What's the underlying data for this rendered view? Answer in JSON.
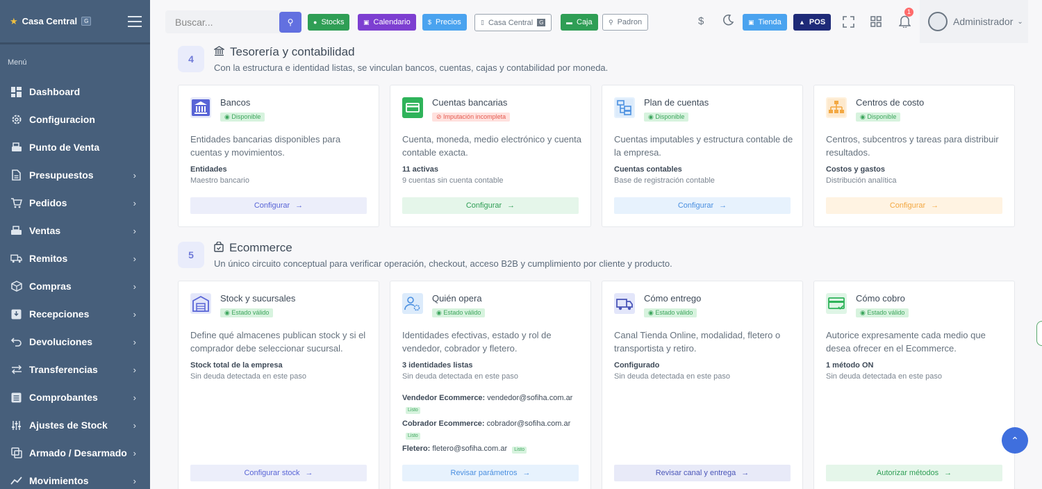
{
  "sidebar": {
    "brand": "Casa Central",
    "brand_badge": "G",
    "menu_title": "Menú",
    "items": [
      {
        "label": "Dashboard",
        "icon": "dashboard-icon",
        "chevron": false
      },
      {
        "label": "Configuracion",
        "icon": "gear-icon",
        "chevron": false
      },
      {
        "label": "Punto de Venta",
        "icon": "pos-icon",
        "chevron": false
      },
      {
        "label": "Presupuestos",
        "icon": "document-icon",
        "chevron": true
      },
      {
        "label": "Pedidos",
        "icon": "cart-icon",
        "chevron": true
      },
      {
        "label": "Ventas",
        "icon": "sales-icon",
        "chevron": true
      },
      {
        "label": "Remitos",
        "icon": "truck-icon",
        "chevron": true
      },
      {
        "label": "Compras",
        "icon": "box-icon",
        "chevron": true
      },
      {
        "label": "Recepciones",
        "icon": "inbox-icon",
        "chevron": true
      },
      {
        "label": "Devoluciones",
        "icon": "undo-icon",
        "chevron": true
      },
      {
        "label": "Transferencias",
        "icon": "transfer-icon",
        "chevron": true
      },
      {
        "label": "Comprobantes",
        "icon": "receipt-icon",
        "chevron": true
      },
      {
        "label": "Ajustes de Stock",
        "icon": "sliders-icon",
        "chevron": true
      },
      {
        "label": "Armado / Desarmado",
        "icon": "layers-icon",
        "chevron": true
      },
      {
        "label": "Movimientos",
        "icon": "chart-line-icon",
        "chevron": true
      }
    ]
  },
  "topbar": {
    "search_placeholder": "Buscar...",
    "buttons": {
      "stocks": "Stocks",
      "calendario": "Calendario",
      "precios": "Precios",
      "casa_central": "Casa Central",
      "casa_badge": "G",
      "caja": "Caja",
      "padron": "Padron",
      "tienda": "Tienda",
      "pos": "POS"
    },
    "notification_count": "1",
    "user": "Administrador"
  },
  "colors": {
    "sidebar": "#475f7b",
    "accent": "#6270e0",
    "green": "#2f9e55",
    "purple": "#7d3fd1",
    "blue": "#4aa3ef",
    "navy": "#1e2a78"
  },
  "section4": {
    "step": "4",
    "title": "Tesorería y contabilidad",
    "description": "Con la estructura e identidad listas, se vinculan bancos, cuentas, cajas y contabilidad por moneda.",
    "cards": [
      {
        "title": "Bancos",
        "badge": "Disponible",
        "desc": "Entidades bancarias disponibles para cuentas y movimientos.",
        "s1": "Entidades",
        "s2": "Maestro bancario",
        "button": "Configurar"
      },
      {
        "title": "Cuentas bancarias",
        "badge": "Imputación incompleta",
        "desc": "Cuenta, moneda, medio electrónico y cuenta contable exacta.",
        "s1": "11 activas",
        "s2": "9 cuentas sin cuenta contable",
        "button": "Configurar"
      },
      {
        "title": "Plan de cuentas",
        "badge": "Disponible",
        "desc": "Cuentas imputables y estructura contable de la empresa.",
        "s1": "Cuentas contables",
        "s2": "Base de registración contable",
        "button": "Configurar"
      },
      {
        "title": "Centros de costo",
        "badge": "Disponible",
        "desc": "Centros, subcentros y tareas para distribuir resultados.",
        "s1": "Costos y gastos",
        "s2": "Distribución analítica",
        "button": "Configurar"
      }
    ]
  },
  "section5": {
    "step": "5",
    "title": "Ecommerce",
    "description": "Un único circuito conceptual para verificar operación, checkout, acceso B2B y cumplimiento por cliente y producto.",
    "cards": [
      {
        "title": "Stock y sucursales",
        "badge": "Estado válido",
        "desc": "Define qué almacenes publican stock y si el comprador debe seleccionar sucursal.",
        "s1": "Stock total de la empresa",
        "s2": "Sin deuda detectada en este paso",
        "button": "Configurar stock"
      },
      {
        "title": "Quién opera",
        "badge": "Estado válido",
        "desc": "Identidades efectivas, estado y rol de vendedor, cobrador y fletero.",
        "s1": "3 identidades listas",
        "s2": "Sin deuda detectada en este paso",
        "button": "Revisar parámetros",
        "roles": [
          {
            "label": "Vendedor Ecommerce:",
            "email": "vendedor@sofiha.com.ar",
            "status": "Listo"
          },
          {
            "label": "Cobrador Ecommerce:",
            "email": "cobrador@sofiha.com.ar",
            "status": "Listo"
          },
          {
            "label": "Fletero:",
            "email": "fletero@sofiha.com.ar",
            "status": "Listo"
          }
        ]
      },
      {
        "title": "Cómo entrego",
        "badge": "Estado válido",
        "desc": "Canal Tienda Online, modalidad, fletero o transportista y retiro.",
        "s1": "Configurado",
        "s2": "Sin deuda detectada en este paso",
        "button": "Revisar canal y entrega"
      },
      {
        "title": "Cómo cobro",
        "badge": "Estado válido",
        "desc": "Autorice expresamente cada medio que desea ofrecer en el Ecommerce.",
        "s1": "1 método ON",
        "s2": "Sin deuda detectada en este paso",
        "button": "Autorizar métodos"
      }
    ]
  }
}
